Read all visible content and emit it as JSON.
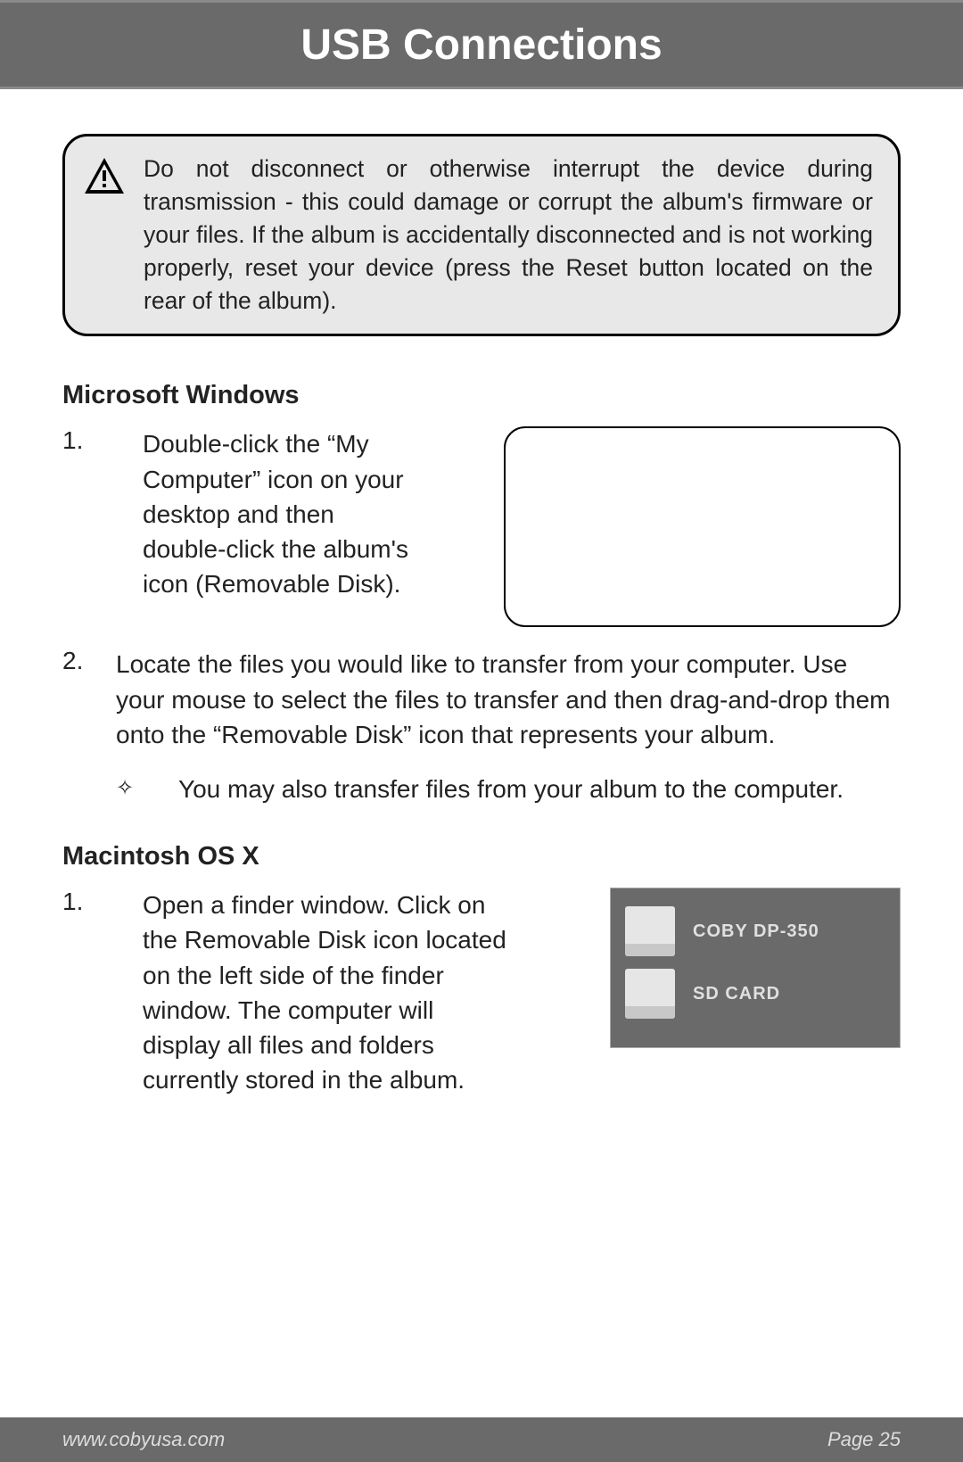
{
  "header": {
    "title": "USB Connections"
  },
  "warning": {
    "text": "Do not disconnect or otherwise interrupt the device during transmission - this could damage or corrupt the album's firmware or your files. If the album is accidentally disconnected and is not working properly, reset your device (press the Reset button located on the rear of the album)."
  },
  "windows": {
    "heading": "Microsoft Windows",
    "steps": [
      {
        "num": "1.",
        "text": "Double-click the “My Computer” icon on your desktop and then double-click the album's icon (Removable Disk)."
      },
      {
        "num": "2.",
        "text": "Locate the files you would like to transfer from your computer. Use your mouse to select the files to transfer and then drag-and-drop them onto the “Removable Disk” icon that represents your album."
      }
    ],
    "sub_bullet": "You may also transfer files from your album to the computer."
  },
  "mac": {
    "heading": "Macintosh OS X",
    "steps": [
      {
        "num": "1.",
        "text": "Open a finder window. Click on the Removable Disk icon located on the left side of the finder window. The computer will display all files and folders currently stored in the album."
      }
    ],
    "drives": [
      {
        "label": "COBY DP-350"
      },
      {
        "label": "SD CARD"
      }
    ]
  },
  "footer": {
    "url": "www.cobyusa.com",
    "page": "Page 25"
  }
}
